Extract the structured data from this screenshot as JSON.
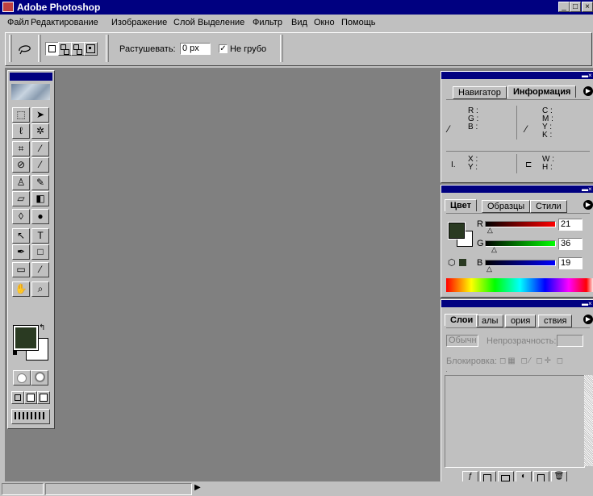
{
  "window": {
    "title": "Adobe Photoshop",
    "buttons": [
      "_",
      "□",
      "×"
    ]
  },
  "menu": [
    "Файл",
    "Редактирование",
    "Изображение",
    "Слой",
    "Выделение",
    "Фильтр",
    "Вид",
    "Окно",
    "Помощь"
  ],
  "options_bar": {
    "feather_label": "Растушевать:",
    "feather_value": "0 px",
    "antialias_label": "Не грубо",
    "antialias_checked": true
  },
  "toolbox": {
    "tools": [
      "marquee-icon",
      "move-icon",
      "lasso-icon",
      "magic-wand-icon",
      "crop-icon",
      "slice-icon",
      "healing-brush-icon",
      "brush-icon",
      "clone-stamp-icon",
      "history-brush-icon",
      "eraser-icon",
      "gradient-icon",
      "blur-icon",
      "dodge-icon",
      "path-select-icon",
      "type-icon",
      "pen-icon",
      "shape-icon",
      "notes-icon",
      "eyedropper-icon",
      "hand-icon",
      "zoom-icon"
    ],
    "foreground_color": "#2a3a22",
    "background_color": "#ffffff"
  },
  "navigator_palette": {
    "tabs": [
      "Навигатор",
      "Информация"
    ],
    "active_tab": "Информация",
    "rgb_labels": [
      "R :",
      "G :",
      "B :"
    ],
    "cmyk_labels": [
      "C :",
      "M :",
      "Y :",
      "K :"
    ],
    "xy_labels": [
      "X :",
      "Y :"
    ],
    "wh_labels": [
      "W :",
      "H :"
    ]
  },
  "color_palette": {
    "tabs": [
      "Цвет",
      "Образцы",
      "Стили"
    ],
    "active_tab": "Цвет",
    "channels": [
      {
        "label": "R",
        "value": "21",
        "fraction": 0.08
      },
      {
        "label": "G",
        "value": "36",
        "fraction": 0.14
      },
      {
        "label": "B",
        "value": "19",
        "fraction": 0.07
      }
    ],
    "swatch": "#2a3a22"
  },
  "layers_palette": {
    "tabs": [
      "Слои",
      "Каналы",
      "История",
      "Действия"
    ],
    "tab_visible_text": [
      "Слои",
      "алы",
      "ория",
      "ствия"
    ],
    "blend_mode": "Обычн",
    "opacity_label": "Непрозрачность:",
    "lock_label": "Блокировка:"
  }
}
